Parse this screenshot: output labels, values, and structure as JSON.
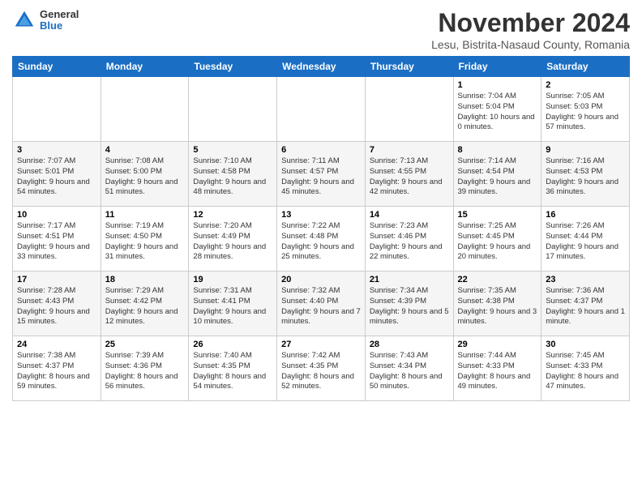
{
  "logo": {
    "general": "General",
    "blue": "Blue"
  },
  "title": "November 2024",
  "subtitle": "Lesu, Bistrita-Nasaud County, Romania",
  "days_of_week": [
    "Sunday",
    "Monday",
    "Tuesday",
    "Wednesday",
    "Thursday",
    "Friday",
    "Saturday"
  ],
  "weeks": [
    [
      {
        "day": "",
        "info": ""
      },
      {
        "day": "",
        "info": ""
      },
      {
        "day": "",
        "info": ""
      },
      {
        "day": "",
        "info": ""
      },
      {
        "day": "",
        "info": ""
      },
      {
        "day": "1",
        "info": "Sunrise: 7:04 AM\nSunset: 5:04 PM\nDaylight: 10 hours and 0 minutes."
      },
      {
        "day": "2",
        "info": "Sunrise: 7:05 AM\nSunset: 5:03 PM\nDaylight: 9 hours and 57 minutes."
      }
    ],
    [
      {
        "day": "3",
        "info": "Sunrise: 7:07 AM\nSunset: 5:01 PM\nDaylight: 9 hours and 54 minutes."
      },
      {
        "day": "4",
        "info": "Sunrise: 7:08 AM\nSunset: 5:00 PM\nDaylight: 9 hours and 51 minutes."
      },
      {
        "day": "5",
        "info": "Sunrise: 7:10 AM\nSunset: 4:58 PM\nDaylight: 9 hours and 48 minutes."
      },
      {
        "day": "6",
        "info": "Sunrise: 7:11 AM\nSunset: 4:57 PM\nDaylight: 9 hours and 45 minutes."
      },
      {
        "day": "7",
        "info": "Sunrise: 7:13 AM\nSunset: 4:55 PM\nDaylight: 9 hours and 42 minutes."
      },
      {
        "day": "8",
        "info": "Sunrise: 7:14 AM\nSunset: 4:54 PM\nDaylight: 9 hours and 39 minutes."
      },
      {
        "day": "9",
        "info": "Sunrise: 7:16 AM\nSunset: 4:53 PM\nDaylight: 9 hours and 36 minutes."
      }
    ],
    [
      {
        "day": "10",
        "info": "Sunrise: 7:17 AM\nSunset: 4:51 PM\nDaylight: 9 hours and 33 minutes."
      },
      {
        "day": "11",
        "info": "Sunrise: 7:19 AM\nSunset: 4:50 PM\nDaylight: 9 hours and 31 minutes."
      },
      {
        "day": "12",
        "info": "Sunrise: 7:20 AM\nSunset: 4:49 PM\nDaylight: 9 hours and 28 minutes."
      },
      {
        "day": "13",
        "info": "Sunrise: 7:22 AM\nSunset: 4:48 PM\nDaylight: 9 hours and 25 minutes."
      },
      {
        "day": "14",
        "info": "Sunrise: 7:23 AM\nSunset: 4:46 PM\nDaylight: 9 hours and 22 minutes."
      },
      {
        "day": "15",
        "info": "Sunrise: 7:25 AM\nSunset: 4:45 PM\nDaylight: 9 hours and 20 minutes."
      },
      {
        "day": "16",
        "info": "Sunrise: 7:26 AM\nSunset: 4:44 PM\nDaylight: 9 hours and 17 minutes."
      }
    ],
    [
      {
        "day": "17",
        "info": "Sunrise: 7:28 AM\nSunset: 4:43 PM\nDaylight: 9 hours and 15 minutes."
      },
      {
        "day": "18",
        "info": "Sunrise: 7:29 AM\nSunset: 4:42 PM\nDaylight: 9 hours and 12 minutes."
      },
      {
        "day": "19",
        "info": "Sunrise: 7:31 AM\nSunset: 4:41 PM\nDaylight: 9 hours and 10 minutes."
      },
      {
        "day": "20",
        "info": "Sunrise: 7:32 AM\nSunset: 4:40 PM\nDaylight: 9 hours and 7 minutes."
      },
      {
        "day": "21",
        "info": "Sunrise: 7:34 AM\nSunset: 4:39 PM\nDaylight: 9 hours and 5 minutes."
      },
      {
        "day": "22",
        "info": "Sunrise: 7:35 AM\nSunset: 4:38 PM\nDaylight: 9 hours and 3 minutes."
      },
      {
        "day": "23",
        "info": "Sunrise: 7:36 AM\nSunset: 4:37 PM\nDaylight: 9 hours and 1 minute."
      }
    ],
    [
      {
        "day": "24",
        "info": "Sunrise: 7:38 AM\nSunset: 4:37 PM\nDaylight: 8 hours and 59 minutes."
      },
      {
        "day": "25",
        "info": "Sunrise: 7:39 AM\nSunset: 4:36 PM\nDaylight: 8 hours and 56 minutes."
      },
      {
        "day": "26",
        "info": "Sunrise: 7:40 AM\nSunset: 4:35 PM\nDaylight: 8 hours and 54 minutes."
      },
      {
        "day": "27",
        "info": "Sunrise: 7:42 AM\nSunset: 4:35 PM\nDaylight: 8 hours and 52 minutes."
      },
      {
        "day": "28",
        "info": "Sunrise: 7:43 AM\nSunset: 4:34 PM\nDaylight: 8 hours and 50 minutes."
      },
      {
        "day": "29",
        "info": "Sunrise: 7:44 AM\nSunset: 4:33 PM\nDaylight: 8 hours and 49 minutes."
      },
      {
        "day": "30",
        "info": "Sunrise: 7:45 AM\nSunset: 4:33 PM\nDaylight: 8 hours and 47 minutes."
      }
    ]
  ]
}
